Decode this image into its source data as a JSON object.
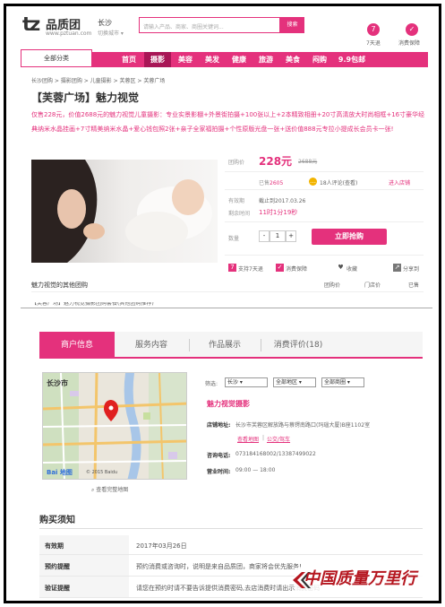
{
  "header": {
    "logo_mark": "tz",
    "logo_name": "品质团",
    "logo_url": "www.pztuan.com",
    "city": "长沙",
    "city_switch": "切换城市 ▾",
    "search_placeholder": "请输入产品、商家、商圈关键词...",
    "search_button": "搜索",
    "link_7day": "7天退",
    "link_guarantee": "消费保障"
  },
  "nav": {
    "all_categories": "全部分类",
    "items": [
      "首页",
      "摄影",
      "美容",
      "美发",
      "健康",
      "旅游",
      "美食",
      "闷购",
      "9.9包邮"
    ],
    "active_index": 1
  },
  "breadcrumb": "长沙团购 > 摄影团购 > 儿童摄影 > 芙蓉区 > 芙蓉广场",
  "deal": {
    "title": "【芙蓉广场】魅力视觉",
    "description": "仅售228元，价值2688元的魅力视觉儿童摄影：专业实景影棚+外景街拍摄+100张以上+2本精致相册+20寸高清放大时尚相框+16寸豪华经典纳米水晶挂画+7寸精美纳米水晶+爱心钱包照2张+亲子全家福拍摄+个性原版光盘一张+送价值888元专拉小提成长会员卡一张!",
    "price_label": "团购价",
    "price": "228元",
    "original_price": "2688元",
    "sold_label": "已售",
    "sold": "2605",
    "reviews": "18人评论(查看)",
    "enter_store": "进入店铺",
    "valid_label": "有效期",
    "valid_value": "截止到2017.03.26",
    "remaining_label": "剩余时间",
    "remaining_value": "11时1分19秒",
    "qty_label": "数量",
    "qty_minus": "-",
    "qty": "1",
    "qty_plus": "+",
    "buy_button": "立即抢购",
    "action_7day": "支持7天退",
    "action_guarantee": "消费保障",
    "action_favorite": "收藏",
    "action_share": "分享到"
  },
  "other_deals": {
    "title": "魅力视觉的其他团购",
    "col_group_price": "团购价",
    "col_store_price": "门店价",
    "col_sold": "已售",
    "row_cut": "【芙蓉广场】魅力视觉摄影团购套餐(其他团购推荐)"
  },
  "tabs": [
    "商户信息",
    "服务内容",
    "作品展示",
    "消费评价(18)"
  ],
  "merchant": {
    "map_city_label": "长沙市",
    "map_brand": "Bai 地图",
    "map_copyright": "© 2015 Baidu",
    "map_link": "查看完整地图",
    "filter_label": "筛选:",
    "filter_city": "长沙",
    "filter_district": "全部地区",
    "filter_area": "全部商圈",
    "shop_name": "魅力视觉摄影",
    "address_label": "店铺地址:",
    "address": "长沙市芙蓉区解放路与蔡锷南路口(玛瑙大厦)B座1102室",
    "view_map": "查看地图",
    "bus_route": "公交/驾车",
    "phone_label": "咨询电话:",
    "phone": "073184168002/13387499022",
    "hours_label": "营业时间:",
    "hours": "09:00 — 18:00"
  },
  "notes": {
    "title": "购买须知",
    "rows": [
      {
        "key": "有效期",
        "value": "2017年03月26日"
      },
      {
        "key": "预约提醒",
        "value": "预约消费或咨询时，说明是来自品质团，商家将会优先服务!"
      },
      {
        "key": "验证提醒",
        "value": "请您在预约时请不要告诉提供消费密码,去店消费时请出示消费密码"
      }
    ]
  },
  "watermark": "中国质量万里行",
  "colors": {
    "brand": "#e4317c",
    "brand_dark": "#a81656",
    "watermark": "#b5161f"
  }
}
